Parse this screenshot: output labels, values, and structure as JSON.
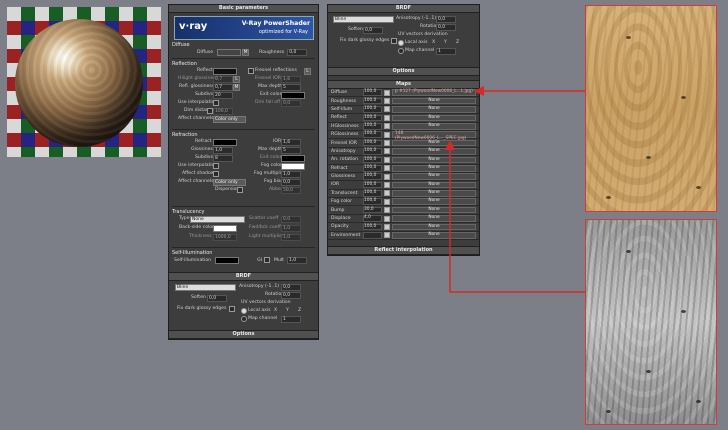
{
  "left_panel": {
    "basic_header": "Basic parameters",
    "banner": {
      "logo": "v·ray",
      "title": "V-Ray PowerShader",
      "subtitle": "optimized for V-Ray"
    },
    "diffuse": {
      "group": "Diffuse",
      "diffuse_label": "Diffuse",
      "map_btn": "M",
      "roughness_label": "Roughness",
      "roughness": "0,0"
    },
    "reflection": {
      "group": "Reflection",
      "reflect": "Reflect",
      "hilight": "Hilight glossiness",
      "hilight_val": "0,7",
      "lock": "L",
      "refl_gloss": "Refl. glossiness",
      "refl_gloss_val": "0,7",
      "m": "M",
      "subdivs": "Subdivs",
      "subdivs_val": "20",
      "use_interp": "Use interpolation",
      "dim_dist": "Dim distance",
      "dim_dist_val": "100,0",
      "affect_channels": "Affect channels",
      "affect_val": "Color only",
      "fresnel": "Fresnel reflections",
      "fresnel_l": "L",
      "fresnel_ior": "Fresnel IOR",
      "fresnel_ior_val": "1,6",
      "max_depth": "Max depth",
      "max_depth_val": "5",
      "exit_color": "Exit color",
      "dim_falloff": "Dim fall off",
      "dim_falloff_val": "0,0"
    },
    "refraction": {
      "group": "Refraction",
      "refract": "Refract",
      "ior": "IOR",
      "ior_val": "1,6",
      "glossiness": "Glossiness",
      "glossiness_val": "1,0",
      "max_depth": "Max depth",
      "max_depth_val": "5",
      "subdivs": "Subdivs",
      "subdivs_val": "8",
      "exit_color": "Exit color",
      "use_interp": "Use interpolation",
      "fog_color": "Fog color",
      "affect_shadows": "Affect shadows",
      "fog_mult": "Fog multiplier",
      "fog_mult_val": "1,0",
      "affect_channels": "Affect channels",
      "affect_val": "Color only",
      "fog_bias": "Fog bias",
      "fog_bias_val": "0,0",
      "dispersion": "Dispersion",
      "abbe": "Abbe",
      "abbe_val": "50,0"
    },
    "translucency": {
      "group": "Translucency",
      "type": "Type",
      "type_val": "None",
      "back_side": "Back-side color",
      "thickness": "Thickness",
      "thickness_val": "1000,0",
      "scatter": "Scatter coeff",
      "scatter_val": "0,0",
      "fwd_bck": "Fwd/bck coeff",
      "fwd_bck_val": "1,0",
      "light_mult": "Light multiplier",
      "light_mult_val": "1,0"
    },
    "self_illum": {
      "group": "Self-Illumination",
      "label": "Self-illumination",
      "gi": "GI",
      "mult": "Mult",
      "mult_val": "1,0"
    },
    "brdf_header": "BRDF",
    "brdf": {
      "type": "Blinn",
      "aniso": "Anisotropy (-1..1)",
      "aniso_val": "0,0",
      "rotation": "Rotation",
      "rotation_val": "0,0",
      "soften": "Soften",
      "soften_val": "0,0",
      "uv_deriv": "UV vectors derivation",
      "fix_dark": "Fix dark glossy edges",
      "local_axis": "Local axis",
      "x": "X",
      "y": "Y",
      "z": "Z",
      "map_channel": "Map channel",
      "map_channel_val": "1"
    },
    "options_header": "Options"
  },
  "right_panel": {
    "brdf_header": "BRDF",
    "brdf": {
      "type": "Blinn",
      "aniso": "Anisotropy (-1..1)",
      "aniso_val": "0,0",
      "rotation": "Rotation",
      "rotation_val": "0,0",
      "soften": "Soften",
      "soften_val": "0,0",
      "uv_deriv": "UV vectors derivation",
      "fix_dark": "Fix dark glossy edges",
      "local_axis": "Local axis",
      "x": "X",
      "y": "Y",
      "z": "Z",
      "map_channel": "Map channel",
      "map_channel_val": "1"
    },
    "options_header": "Options",
    "maps_header": "Maps",
    "maps": [
      {
        "name": "Diffuse",
        "val": "100,0",
        "map": "p #127 (PlywoodNew0006_L...L.jpg)",
        "hl": true
      },
      {
        "name": "Roughness",
        "val": "100,0",
        "map": "None"
      },
      {
        "name": "Self-illum",
        "val": "100,0",
        "map": "None"
      },
      {
        "name": "Reflect",
        "val": "100,0",
        "map": "None"
      },
      {
        "name": "HGlossiness",
        "val": "100,0",
        "map": "None"
      },
      {
        "name": "RGlossiness",
        "val": "100,0",
        "map": "148 (PlywoodNew0006_L..._SPEC.jpg)",
        "hl": true
      },
      {
        "name": "Fresnel IOR",
        "val": "100,0",
        "map": "None"
      },
      {
        "name": "Anisotropy",
        "val": "100,0",
        "map": "None"
      },
      {
        "name": "An. rotation",
        "val": "100,0",
        "map": "None"
      },
      {
        "name": "Refract",
        "val": "100,0",
        "map": "None"
      },
      {
        "name": "Glossiness",
        "val": "100,0",
        "map": "None"
      },
      {
        "name": "IOR",
        "val": "100,0",
        "map": "None"
      },
      {
        "name": "Translucent",
        "val": "100,0",
        "map": "None"
      },
      {
        "name": "Fog color",
        "val": "100,0",
        "map": "None"
      },
      {
        "name": "Bump",
        "val": "30,0",
        "map": "None"
      },
      {
        "name": "Displace",
        "val": "4,0",
        "map": "None"
      },
      {
        "name": "Opacity",
        "val": "100,0",
        "map": "None"
      },
      {
        "name": "Environment",
        "val": "",
        "map": "None"
      }
    ],
    "reflect_interp_header": "Reflect interpolation"
  },
  "colors": {
    "arrow": "#d42a2a",
    "panel_bg": "#3d3d3d",
    "banner": "#1e3a7a"
  }
}
